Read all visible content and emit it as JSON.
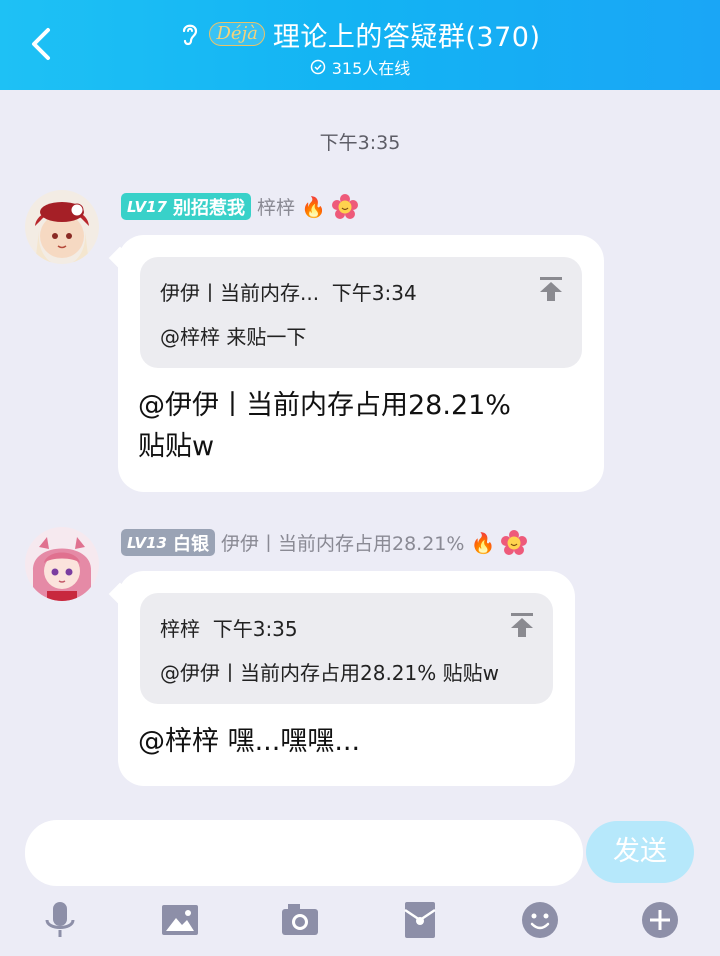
{
  "header": {
    "back_icon": "chevron-left-icon",
    "ear_icon": "ear-icon",
    "logo_text": "Déjà",
    "title": "理论上的答疑群(370)",
    "online_text": "315人在线"
  },
  "timestamp": "下午3:35",
  "messages": [
    {
      "level": "LV17",
      "title_badge": "别招惹我",
      "badge_color": "#38d1c9",
      "name": "梓梓",
      "quote": {
        "author": "伊伊丨当前内存...",
        "time": "下午3:34",
        "text": "@梓梓 来贴一下"
      },
      "text_line1": "@伊伊丨当前内存占用28.21%",
      "text_line2": "贴贴w"
    },
    {
      "level": "LV13",
      "title_badge": "白银",
      "badge_color": "#9aa3b5",
      "name": "伊伊丨当前内存占用28.21%",
      "quote": {
        "author": "梓梓",
        "time": "下午3:35",
        "text": "@伊伊丨当前内存占用28.21% 贴贴w"
      },
      "text_line1": "@梓梓 嘿...嘿嘿..."
    }
  ],
  "input": {
    "placeholder": "",
    "send_label": "发送"
  },
  "toolbar": [
    "microphone-icon",
    "image-icon",
    "camera-icon",
    "red-packet-icon",
    "emoji-icon",
    "plus-icon"
  ]
}
